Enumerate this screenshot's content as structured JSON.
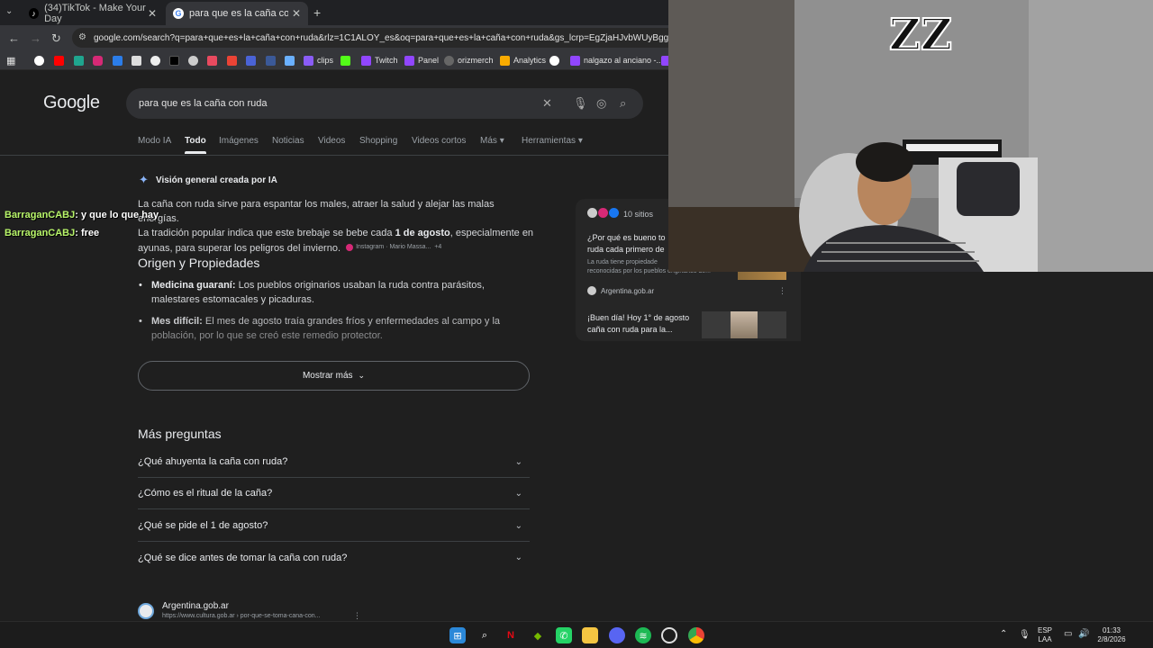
{
  "browser": {
    "tabs": [
      {
        "label": "(34)TikTok - Make Your Day",
        "active": false
      },
      {
        "label": "para que es la caña con ruda -",
        "active": true
      }
    ],
    "url": "google.com/search?q=para+que+es+la+caña+con+ruda&rlz=1C1ALOY_es&oq=para+que+es+la+caña+con+ruda&gs_lcrp=EgZjaHJvbWUyBggAEEUYOT",
    "bookmarks": [
      "clips",
      "Twitch",
      "Panel",
      "orizmerch",
      "Analytics",
      "nalgazo al anciano -..."
    ]
  },
  "google": {
    "logo": "Google",
    "query": "para que es la caña con ruda",
    "tabs": [
      "Modo IA",
      "Todo",
      "Imágenes",
      "Noticias",
      "Videos",
      "Shopping",
      "Videos cortos",
      "Más",
      "Herramientas"
    ],
    "ai_header": "Visión general creada por IA",
    "ai_p1_a": "La caña con ruda sirve para espantar los males, atraer la salud y alejar las malas energías.",
    "ai_p1_b": "La tradición popular indica que este brebaje se bebe cada ",
    "ai_p1_bold": "1 de agosto",
    "ai_p1_c": ", especialmente en",
    "ai_p1_d": "ayunas, para superar los peligros del invierno.",
    "ai_source": "Instagram · Mario Massa...",
    "ai_source_more": "+4",
    "section_title": "Origen y Propiedades",
    "bullets": [
      {
        "bold": "Medicina guaraní:",
        "text": " Los pueblos originarios usaban la ruda contra parásitos,",
        "text2": "malestares estomacales y picaduras."
      },
      {
        "bold": "Mes difícil:",
        "text": " El mes de agosto traía grandes fríos y enfermedades al campo y la",
        "text2": "población, por lo que se creó este remedio protector."
      }
    ],
    "show_more": "Mostrar más",
    "paa_title": "Más preguntas",
    "questions": [
      "¿Qué ahuyenta la caña con ruda?",
      "¿Cómo es el ritual de la caña?",
      "¿Qué se pide el 1 de agosto?",
      "¿Qué se dice antes de tomar la caña con ruda?"
    ],
    "result_site": "Argentina.gob.ar",
    "result_url": "https://www.cultura.gob.ar › por-que-se-toma-cana-con...",
    "sites_card": {
      "count": "10 sitios",
      "card1_title_1": "¿Por qué es bueno to",
      "card1_title_2": "ruda cada primero de",
      "card1_snippet_1": "La ruda tiene propiedade",
      "card1_snippet_2": "reconocidas por los pueblos originarios de...",
      "card1_source": "Argentina.gob.ar",
      "card2_title_1": "¡Buen día! Hoy 1° de agosto",
      "card2_title_2": "caña con ruda para la..."
    }
  },
  "chat": [
    {
      "user": "BarraganCABJ",
      "msg": ": y que lo que hay"
    },
    {
      "user": "BarraganCABJ",
      "msg": ": free"
    }
  ],
  "taskbar": {
    "lang_1": "ESP",
    "lang_2": "LAA",
    "time": "01:33",
    "date": "2/8/2026"
  }
}
